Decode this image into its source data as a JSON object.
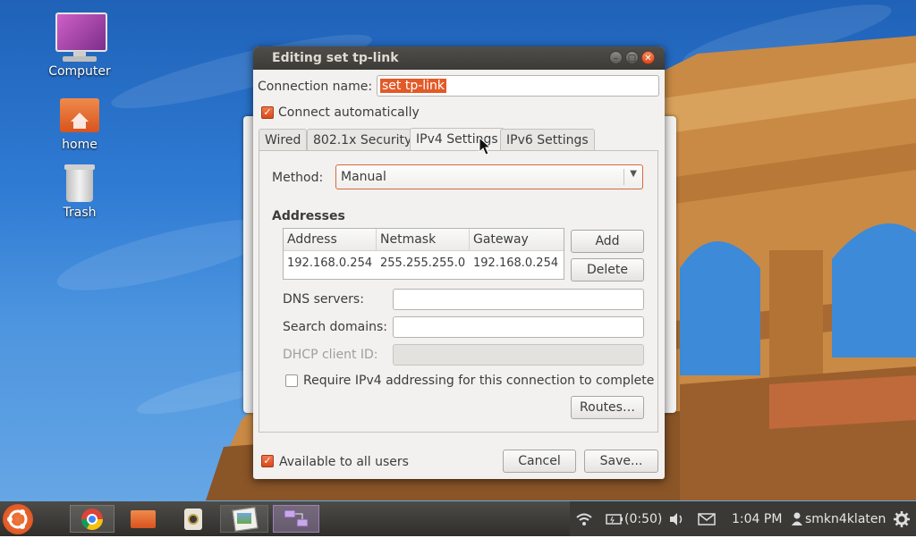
{
  "desktop": {
    "icons": [
      {
        "label": "Computer"
      },
      {
        "label": "home"
      },
      {
        "label": "Trash"
      }
    ]
  },
  "dialog": {
    "title": "Editing set tp-link",
    "connection_name_label": "Connection name:",
    "connection_name_value": "set tp-link",
    "connect_automatically_label": "Connect automatically",
    "connect_automatically_checked": true,
    "tabs": [
      {
        "label": "Wired"
      },
      {
        "label": "802.1x Security"
      },
      {
        "label": "IPv4 Settings",
        "active": true
      },
      {
        "label": "IPv6 Settings"
      }
    ],
    "ipv4": {
      "method_label": "Method:",
      "method_value": "Manual",
      "addresses_heading": "Addresses",
      "columns": [
        "Address",
        "Netmask",
        "Gateway"
      ],
      "rows": [
        [
          "192.168.0.254",
          "255.255.255.0",
          "192.168.0.254"
        ]
      ],
      "add_button": "Add",
      "delete_button": "Delete",
      "dns_label": "DNS servers:",
      "dns_value": "",
      "search_domains_label": "Search domains:",
      "search_domains_value": "",
      "dhcp_client_id_label": "DHCP client ID:",
      "dhcp_client_id_value": "",
      "require_ipv4_label": "Require IPv4 addressing for this connection to complete",
      "require_ipv4_checked": false,
      "routes_button": "Routes…"
    },
    "available_to_all_users_label": "Available to all users",
    "available_to_all_users_checked": true,
    "cancel_button": "Cancel",
    "save_button": "Save..."
  },
  "taskbar": {
    "apps": [
      "ubuntu-icon",
      "chrome-icon",
      "folder-icon",
      "speaker-app-icon",
      "image-viewer-icon",
      "network-connections-icon"
    ],
    "tray": {
      "battery": "(0:50)",
      "time": "1:04 PM",
      "user": "smkn4klaten"
    }
  },
  "colors": {
    "accent": "#e25a28",
    "titlebar": "#3c3b37",
    "taskbar": "#2f2e2b"
  }
}
